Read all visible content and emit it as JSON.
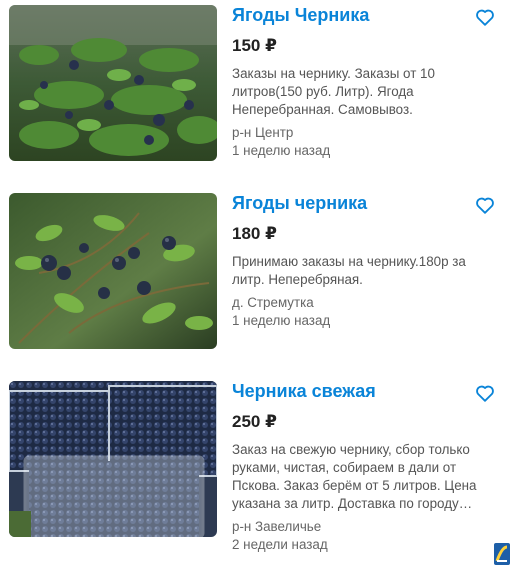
{
  "colors": {
    "accent": "#0a84d8",
    "price": "#222222",
    "text": "#555555"
  },
  "listings": [
    {
      "title": "Ягоды Черника",
      "price": "150 ₽",
      "description": "Заказы на чернику. Заказы от 10 литров(150 руб. Литр). Ягода Неперебранная. Самовывоз.",
      "location": "р-н Центр",
      "posted": "1 неделю назад",
      "image": "blueberry-bush-photo",
      "favorite_icon": "heart-outline-icon"
    },
    {
      "title": "Ягоды черника",
      "price": "180 ₽",
      "description": "Принимаю заказы на чернику.180р за литр. Неперебряная.",
      "location": "д. Стремутка",
      "posted": "1 неделю назад",
      "image": "blueberry-branch-photo",
      "favorite_icon": "heart-outline-icon"
    },
    {
      "title": "Черника свежая",
      "price": "250 ₽",
      "description": "Заказ на свежую чернику, сбор только руками, чистая, собираем в дали от Пскова. Заказ берём от 5 литров. Цена указана за литр. Доставка по городу…",
      "location": "р-н Завеличье",
      "posted": "2 недели назад",
      "image": "blueberry-containers-photo",
      "favorite_icon": "heart-outline-icon"
    }
  ],
  "corner_icon": "app-logo-icon"
}
